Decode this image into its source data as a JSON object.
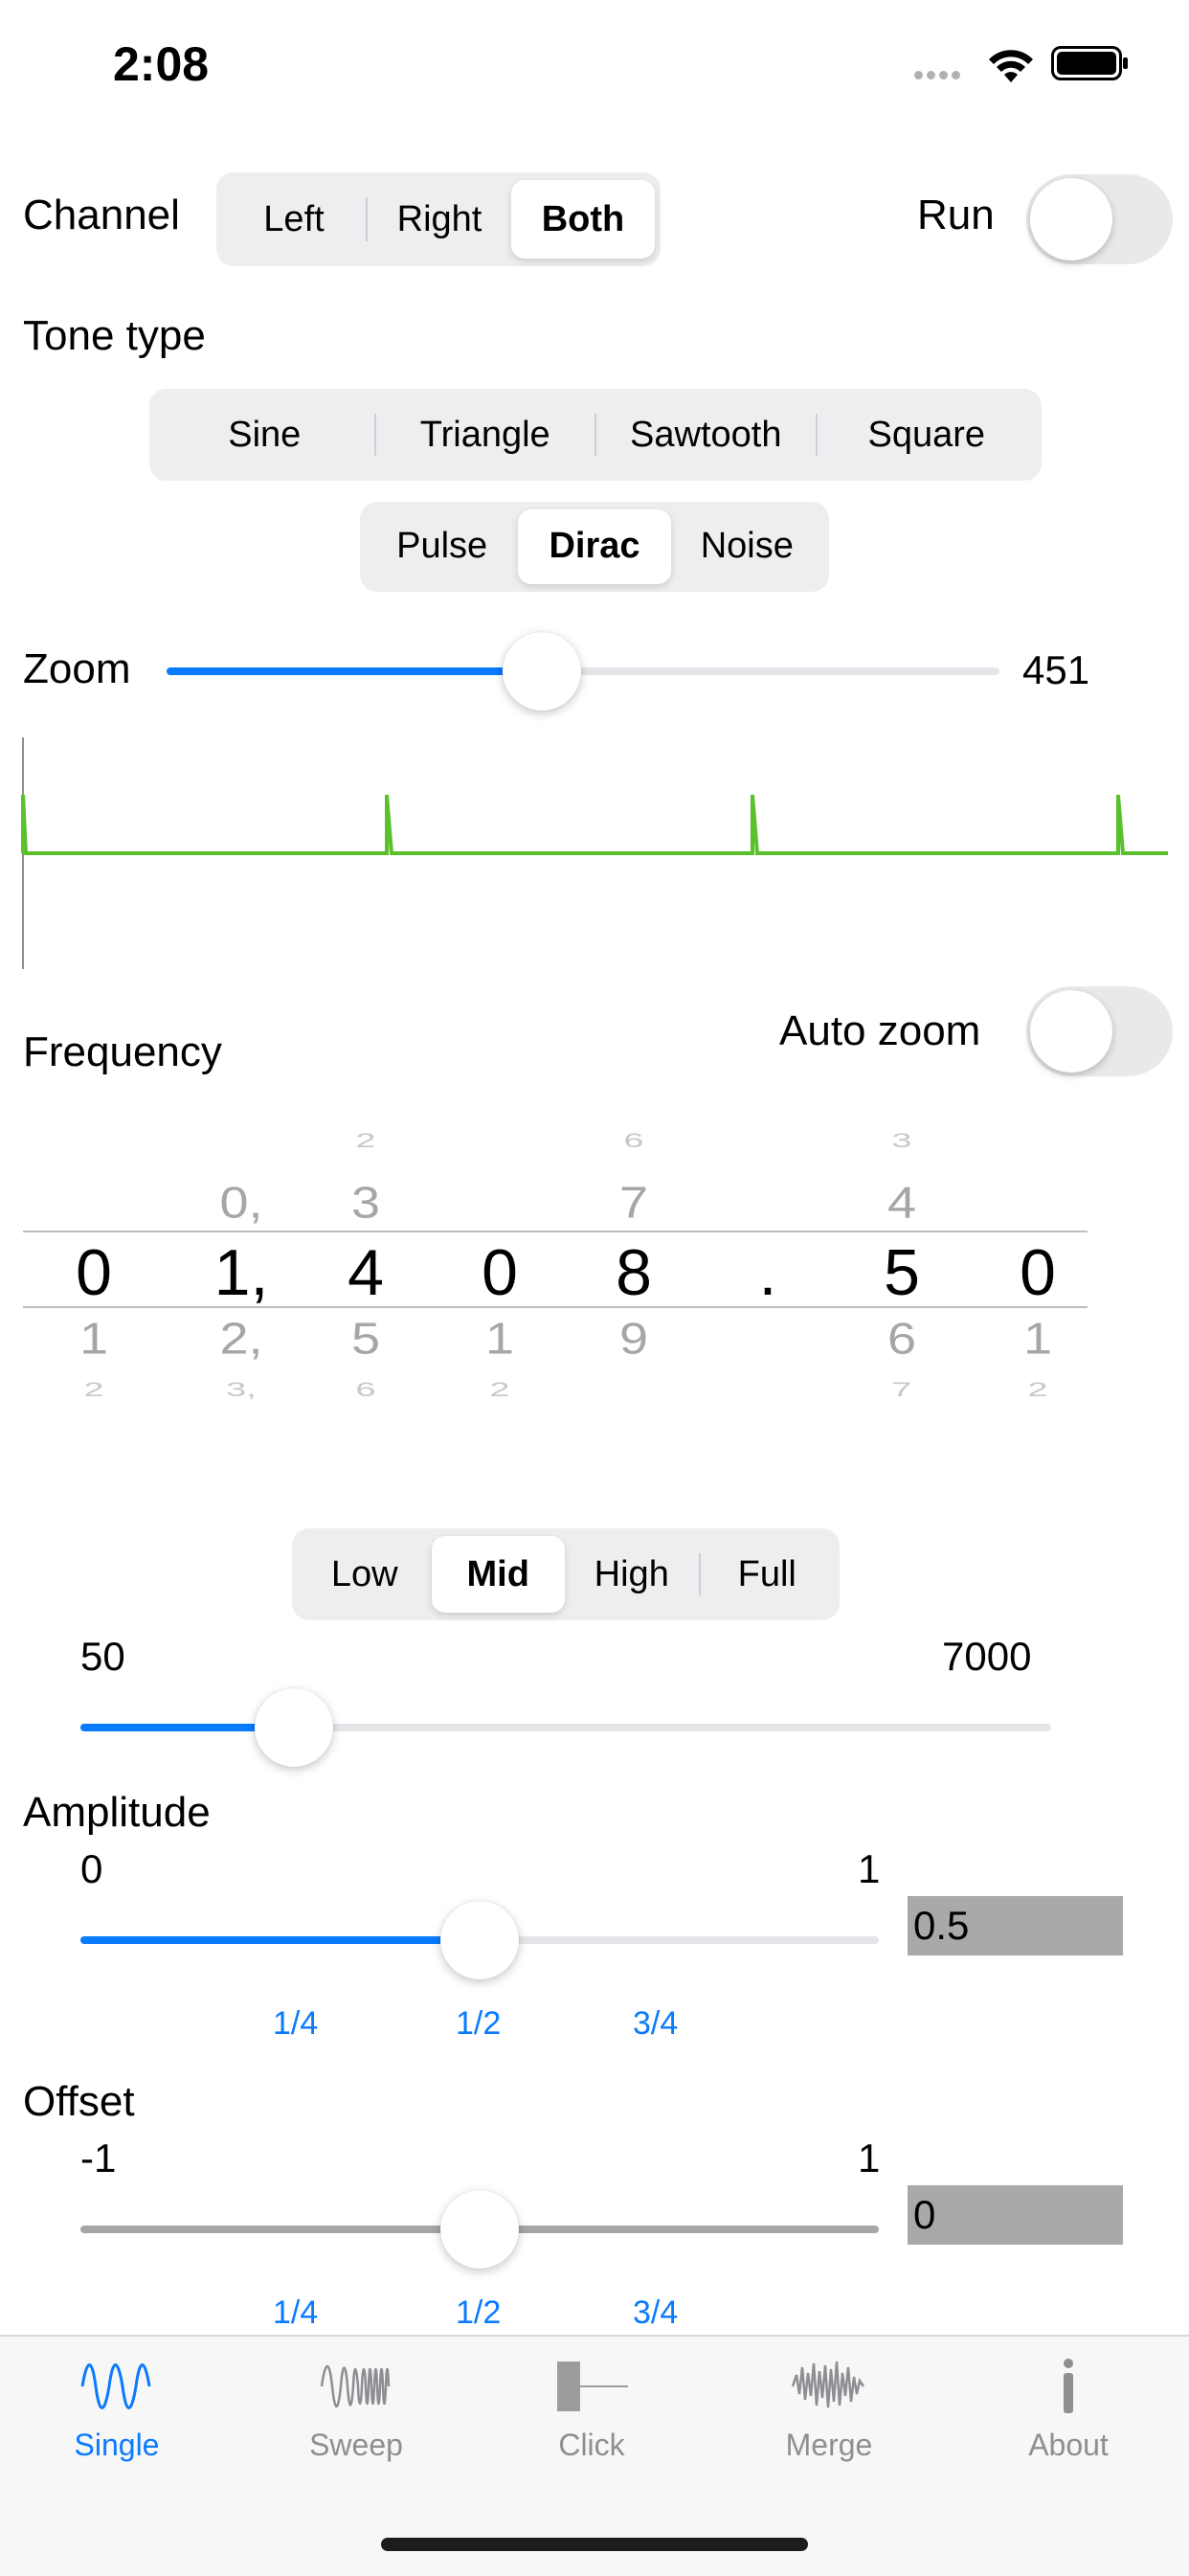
{
  "status_bar": {
    "time": "2:08"
  },
  "channel": {
    "label": "Channel",
    "options": [
      "Left",
      "Right",
      "Both"
    ],
    "selected": "Both"
  },
  "run": {
    "label": "Run",
    "on": false
  },
  "tone_type": {
    "label": "Tone type",
    "row1": [
      "Sine",
      "Triangle",
      "Sawtooth",
      "Square"
    ],
    "row2": [
      "Pulse",
      "Dirac",
      "Noise"
    ],
    "selected": "Dirac"
  },
  "zoom": {
    "label": "Zoom",
    "value": "451",
    "fraction": 0.45
  },
  "waveform": {
    "color": "#5ac02c"
  },
  "auto_zoom": {
    "label": "Auto zoom",
    "on": false
  },
  "frequency": {
    "label": "Frequency",
    "picker": [
      {
        "above2": "",
        "above1": "",
        "selected": "0",
        "below1": "1",
        "below2": "2"
      },
      {
        "above2": "",
        "above1": "0,",
        "selected": "1,",
        "below1": "2,",
        "below2": "3,"
      },
      {
        "above2": "2",
        "above1": "3",
        "selected": "4",
        "below1": "5",
        "below2": "6"
      },
      {
        "above2": "",
        "above1": "",
        "selected": "0",
        "below1": "1",
        "below2": "2"
      },
      {
        "above2": "6",
        "above1": "7",
        "selected": "8",
        "below1": "9",
        "below2": ""
      },
      {
        "above2": "",
        "above1": "",
        "selected": ".",
        "below1": "",
        "below2": ""
      },
      {
        "above2": "3",
        "above1": "4",
        "selected": "5",
        "below1": "6",
        "below2": "7"
      },
      {
        "above2": "",
        "above1": "",
        "selected": "0",
        "below1": "1",
        "below2": "2"
      }
    ],
    "range_options": [
      "Low",
      "Mid",
      "High",
      "Full"
    ],
    "range_selected": "Mid",
    "range_min": "50",
    "range_max": "7000",
    "range_fraction": 0.22
  },
  "amplitude": {
    "label": "Amplitude",
    "min": "0",
    "max": "1",
    "value": "0.5",
    "fraction": 0.5,
    "marks": [
      "1/4",
      "1/2",
      "3/4"
    ]
  },
  "offset": {
    "label": "Offset",
    "min": "-1",
    "max": "1",
    "value": "0",
    "fraction": 0.5,
    "marks": [
      "1/4",
      "1/2",
      "3/4"
    ]
  },
  "tabs": [
    {
      "label": "Single",
      "icon": "sine-wave-icon",
      "active": true
    },
    {
      "label": "Sweep",
      "icon": "sweep-wave-icon",
      "active": false
    },
    {
      "label": "Click",
      "icon": "click-pulse-icon",
      "active": false
    },
    {
      "label": "Merge",
      "icon": "merge-wave-icon",
      "active": false
    },
    {
      "label": "About",
      "icon": "info-icon",
      "active": false
    }
  ],
  "colors": {
    "accent": "#0a7aff",
    "inactive": "#8e8e93",
    "waveform": "#5ac02c"
  }
}
